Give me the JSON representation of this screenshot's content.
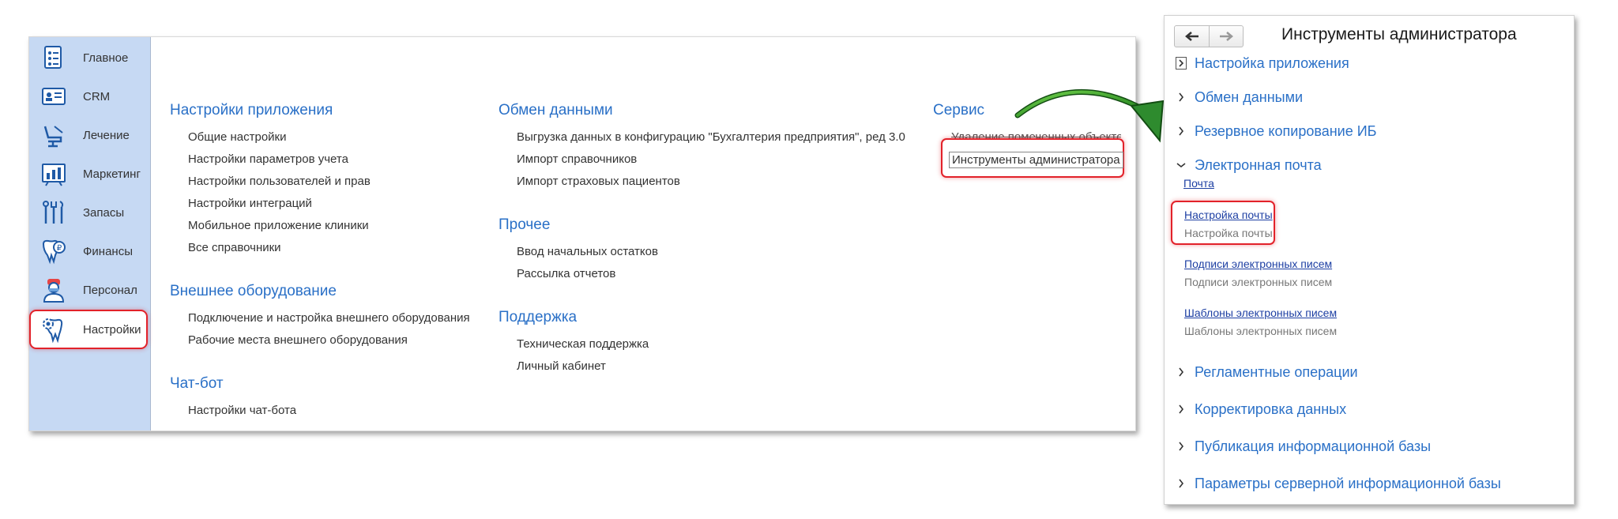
{
  "sidebar": {
    "items": [
      {
        "label": "Главное",
        "icon": "home-icon"
      },
      {
        "label": "CRM",
        "icon": "crm-card-icon"
      },
      {
        "label": "Лечение",
        "icon": "dental-chair-icon"
      },
      {
        "label": "Маркетинг",
        "icon": "marketing-chart-icon"
      },
      {
        "label": "Запасы",
        "icon": "dental-tools-icon"
      },
      {
        "label": "Финансы",
        "icon": "tooth-coin-icon"
      },
      {
        "label": "Персонал",
        "icon": "doctor-icon"
      },
      {
        "label": "Настройки",
        "icon": "tooth-settings-icon"
      }
    ],
    "active_index": 7
  },
  "menu": {
    "app_settings": {
      "title": "Настройки приложения",
      "links": [
        "Общие настройки",
        "Настройки параметров учета",
        "Настройки пользователей и прав",
        "Настройки интеграций",
        "Мобильное приложение клиники",
        "Все справочники"
      ]
    },
    "equipment": {
      "title": "Внешнее оборудование",
      "links": [
        "Подключение и настройка внешнего оборудования",
        "Рабочие места внешнего оборудования"
      ]
    },
    "chatbot": {
      "title": "Чат-бот",
      "links": [
        "Настройки чат-бота"
      ]
    },
    "exchange": {
      "title": "Обмен данными",
      "links": [
        "Выгрузка данных в конфигурацию \"Бухгалтерия предприятия\", ред 3.0",
        "Импорт справочников",
        "Импорт страховых пациентов"
      ]
    },
    "other": {
      "title": "Прочее",
      "links": [
        "Ввод начальных остатков",
        "Рассылка отчетов"
      ]
    },
    "support": {
      "title": "Поддержка",
      "links": [
        "Техническая поддержка",
        "Личный кабинет"
      ]
    },
    "service": {
      "title": "Сервис",
      "obscured_link": "Удаление помеченных объектов",
      "focused_link": "Инструменты администратора"
    }
  },
  "admin_panel": {
    "title": "Инструменты администратора",
    "back_icon": "arrow-left-icon",
    "forward_icon": "arrow-right-icon",
    "sections": [
      {
        "label": "Настройка приложения",
        "expanded": false
      },
      {
        "label": "Обмен данными",
        "expanded": false
      },
      {
        "label": "Резервное копирование ИБ",
        "expanded": false
      },
      {
        "label": "Электронная почта",
        "expanded": true
      },
      {
        "label": "Регламентные операции",
        "expanded": false
      },
      {
        "label": "Корректировка данных",
        "expanded": false
      },
      {
        "label": "Публикация информационной базы",
        "expanded": false
      },
      {
        "label": "Параметры серверной информационной базы",
        "expanded": false
      }
    ],
    "email": {
      "mail_link": "Почта",
      "items": [
        {
          "link": "Настройка почты",
          "desc": "Настройка почты"
        },
        {
          "link": "Подписи электронных писем",
          "desc": "Подписи электронных писем"
        },
        {
          "link": "Шаблоны электронных писем",
          "desc": "Шаблоны электронных писем"
        }
      ]
    }
  },
  "colors": {
    "sidebar_bg": "#c6d9f3",
    "group_title": "#2a70c7",
    "highlight": "#e2222a",
    "arrow": "#2e8b2e",
    "link_blue": "#1d3fa3"
  }
}
